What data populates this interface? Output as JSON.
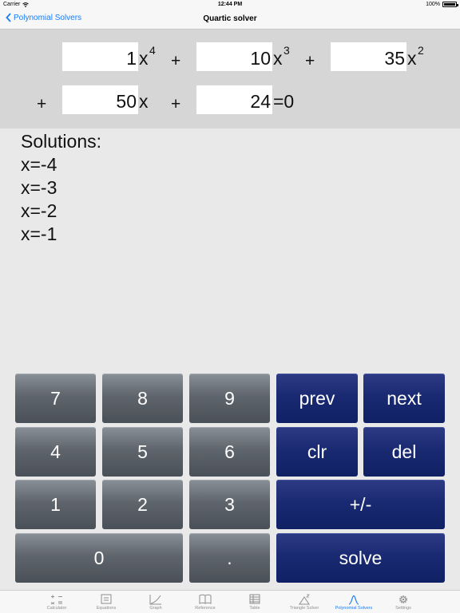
{
  "status": {
    "carrier": "Carrier",
    "time": "12:44 PM",
    "battery": "100%"
  },
  "nav": {
    "back_label": "Polynomial Solvers",
    "title": "Quartic solver"
  },
  "equation": {
    "coef4": "1",
    "coef3": "10",
    "coef2": "35",
    "coef1": "50",
    "coef0": "24",
    "x": "x",
    "exp4": "4",
    "exp3": "3",
    "exp2": "2",
    "plus": "+",
    "equals_zero": "=0"
  },
  "solutions": {
    "heading": "Solutions:",
    "items": [
      "x=-4",
      "x=-3",
      "x=-2",
      "x=-1"
    ]
  },
  "keypad": {
    "k7": "7",
    "k8": "8",
    "k9": "9",
    "prev": "prev",
    "next": "next",
    "k4": "4",
    "k5": "5",
    "k6": "6",
    "clr": "clr",
    "del": "del",
    "k1": "1",
    "k2": "2",
    "k3": "3",
    "plusminus": "+/-",
    "k0": "0",
    "dot": ".",
    "solve": "solve"
  },
  "tabs": [
    {
      "label": "Calculator",
      "icon": "calculator-icon"
    },
    {
      "label": "Equations",
      "icon": "equations-icon"
    },
    {
      "label": "Graph",
      "icon": "graph-icon"
    },
    {
      "label": "Reference",
      "icon": "book-icon"
    },
    {
      "label": "Table",
      "icon": "table-icon"
    },
    {
      "label": "Triangle Solver",
      "icon": "triangle-icon"
    },
    {
      "label": "Polynomial Solvers",
      "icon": "polynomial-icon",
      "active": true
    },
    {
      "label": "Settings",
      "icon": "gear-icon"
    }
  ],
  "colors": {
    "accent": "#1a7cf5",
    "key_gray": "#5f656c",
    "key_blue": "#1a2a72",
    "equation_bg": "#d6d6d6"
  }
}
